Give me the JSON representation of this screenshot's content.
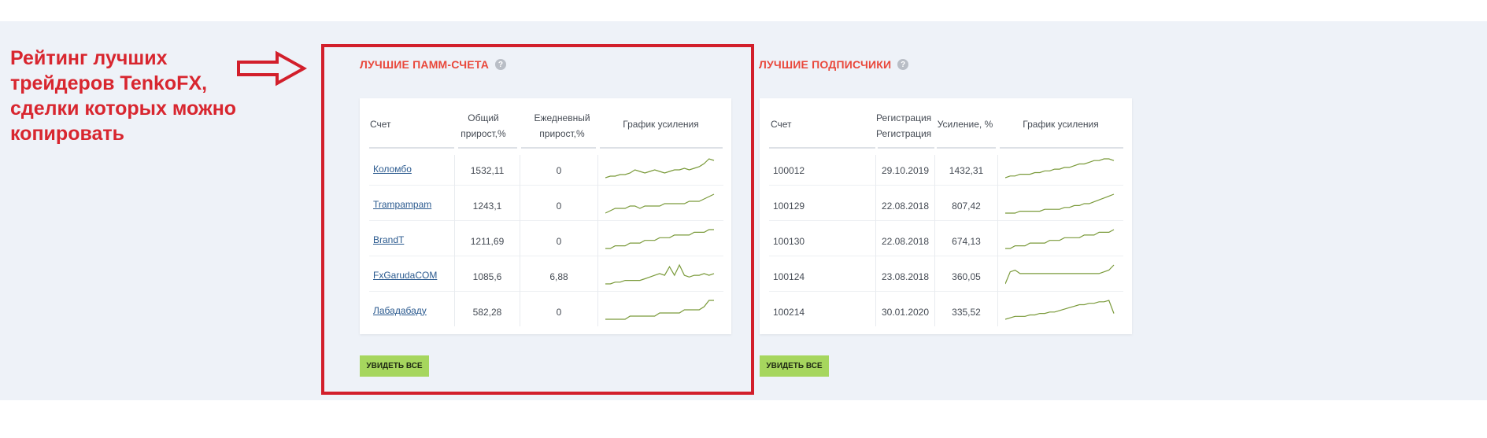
{
  "annotation": {
    "lines": [
      "Рейтинг лучших",
      "трейдеров TenkoFX,",
      "сделки которых можно",
      "копировать"
    ],
    "color": "#d8262f"
  },
  "pamm": {
    "title": "ЛУЧШИЕ ПАММ-СЧЕТА",
    "help_icon": "question-circle-icon",
    "headers": {
      "account": "Счет",
      "total_growth": [
        "Общий",
        "прирост,%"
      ],
      "daily_growth": [
        "Ежедневный",
        "прирост,%"
      ],
      "chart": "График усиления"
    },
    "rows": [
      {
        "name": "Коломбо",
        "total": "1532,11",
        "daily": "0",
        "spark": [
          4,
          5,
          5,
          6,
          6,
          7,
          9,
          8,
          7,
          8,
          9,
          8,
          7,
          8,
          9,
          9,
          10,
          9,
          10,
          11,
          13,
          16,
          15
        ]
      },
      {
        "name": "Trampampam",
        "total": "1243,1",
        "daily": "0",
        "spark": [
          4,
          5,
          6,
          6,
          6,
          7,
          7,
          6,
          7,
          7,
          7,
          7,
          8,
          8,
          8,
          8,
          8,
          9,
          9,
          9,
          10,
          11,
          12
        ]
      },
      {
        "name": "BrandT",
        "total": "1211,69",
        "daily": "0",
        "spark": [
          3,
          3,
          4,
          4,
          4,
          5,
          5,
          5,
          6,
          6,
          6,
          7,
          7,
          7,
          8,
          8,
          8,
          8,
          9,
          9,
          9,
          10,
          10
        ]
      },
      {
        "name": "FxGarudaCOM",
        "total": "1085,6",
        "daily": "6,88",
        "spark": [
          4,
          4,
          5,
          5,
          6,
          6,
          6,
          6,
          7,
          8,
          9,
          10,
          9,
          14,
          9,
          15,
          9,
          8,
          9,
          9,
          10,
          9,
          10
        ]
      },
      {
        "name": "Лабадабаду",
        "total": "582,28",
        "daily": "0",
        "spark": [
          3,
          3,
          3,
          3,
          3,
          4,
          4,
          4,
          4,
          4,
          4,
          5,
          5,
          5,
          5,
          5,
          6,
          6,
          6,
          6,
          7,
          9,
          9
        ]
      }
    ],
    "button_label": "УВИДЕТЬ ВСЕ"
  },
  "subscribers": {
    "title": "ЛУЧШИЕ ПОДПИСЧИКИ",
    "help_icon": "question-circle-icon",
    "headers": {
      "account": "Счет",
      "registration": [
        "Регистрация",
        "Регистрация"
      ],
      "gain": "Усиление, %",
      "chart": "График усиления"
    },
    "rows": [
      {
        "account": "100012",
        "registered": "29.10.2019",
        "gain": "1432,31",
        "spark": [
          2,
          3,
          3,
          4,
          4,
          4,
          5,
          5,
          6,
          6,
          7,
          7,
          8,
          8,
          9,
          10,
          10,
          11,
          12,
          12,
          13,
          13,
          12
        ]
      },
      {
        "account": "100129",
        "registered": "22.08.2018",
        "gain": "807,42",
        "spark": [
          3,
          3,
          3,
          4,
          4,
          4,
          4,
          4,
          5,
          5,
          5,
          5,
          6,
          6,
          7,
          7,
          8,
          8,
          9,
          10,
          11,
          12,
          13
        ]
      },
      {
        "account": "100130",
        "registered": "22.08.2018",
        "gain": "674,13",
        "spark": [
          3,
          3,
          4,
          4,
          4,
          5,
          5,
          5,
          5,
          6,
          6,
          6,
          7,
          7,
          7,
          7,
          8,
          8,
          8,
          9,
          9,
          9,
          10
        ]
      },
      {
        "account": "100124",
        "registered": "23.08.2018",
        "gain": "360,05",
        "spark": [
          3,
          10,
          11,
          9,
          9,
          9,
          9,
          9,
          9,
          9,
          9,
          9,
          9,
          9,
          9,
          9,
          9,
          9,
          9,
          9,
          10,
          11,
          14
        ]
      },
      {
        "account": "100214",
        "registered": "30.01.2020",
        "gain": "335,52",
        "spark": [
          2,
          3,
          4,
          4,
          4,
          5,
          5,
          6,
          6,
          7,
          7,
          8,
          9,
          10,
          11,
          12,
          12,
          13,
          13,
          14,
          14,
          15,
          6
        ]
      }
    ],
    "button_label": "УВИДЕТЬ ВСЕ"
  },
  "colors": {
    "title_red": "#e9483b",
    "frame_red": "#d21f2b",
    "sparkline": "#7a9a3a",
    "button_green": "#a6d65e",
    "link_blue": "#2b5a8f",
    "page_band": "#eef2f8"
  }
}
